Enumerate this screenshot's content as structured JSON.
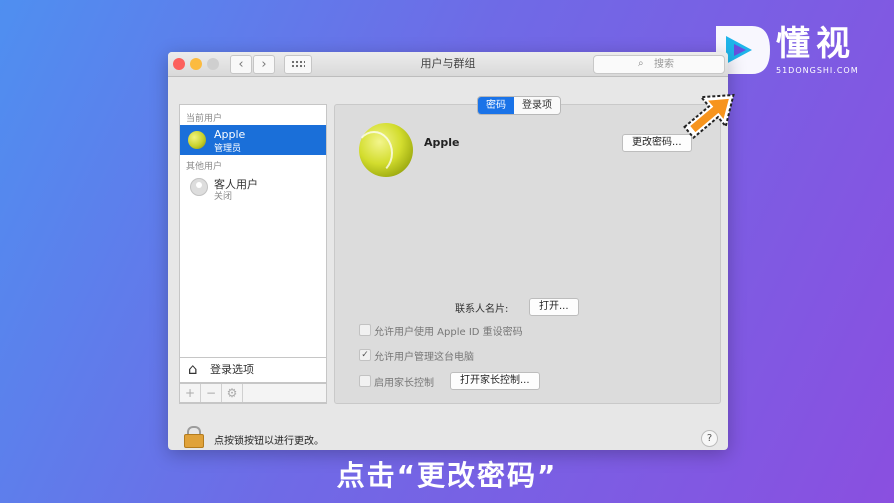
{
  "brand": {
    "name": "懂视",
    "domain": "51DONGSHI.COM"
  },
  "window": {
    "title": "用户与群组",
    "search": {
      "placeholder": "搜索",
      "icon": "search-icon"
    }
  },
  "sidebar": {
    "current_section": "当前用户",
    "other_section": "其他用户",
    "users": [
      {
        "name": "Apple",
        "role": "管理员",
        "selected": true
      },
      {
        "name": "客人用户",
        "role": "关闭",
        "selected": false
      }
    ],
    "login_options_label": "登录选项",
    "tools": {
      "add": "+",
      "remove": "−"
    }
  },
  "main": {
    "tabs": [
      {
        "label": "密码",
        "active": true
      },
      {
        "label": "登录项",
        "active": false
      }
    ],
    "user_name": "Apple",
    "change_password_label": "更改密码...",
    "contact_card_label": "联系人名片:",
    "open_label": "打开...",
    "options": [
      {
        "label": "允许用户使用 Apple ID 重设密码",
        "checked": false
      },
      {
        "label": "允许用户管理这台电脑",
        "checked": true
      },
      {
        "label": "启用家长控制",
        "checked": false
      }
    ],
    "parental_controls_label": "打开家长控制..."
  },
  "footer": {
    "lock_text": "点按锁按钮以进行更改。",
    "help_label": "?"
  },
  "caption": "点击“更改密码”",
  "colors": {
    "accent": "#1a73e8",
    "arrow": "#f7941d"
  }
}
